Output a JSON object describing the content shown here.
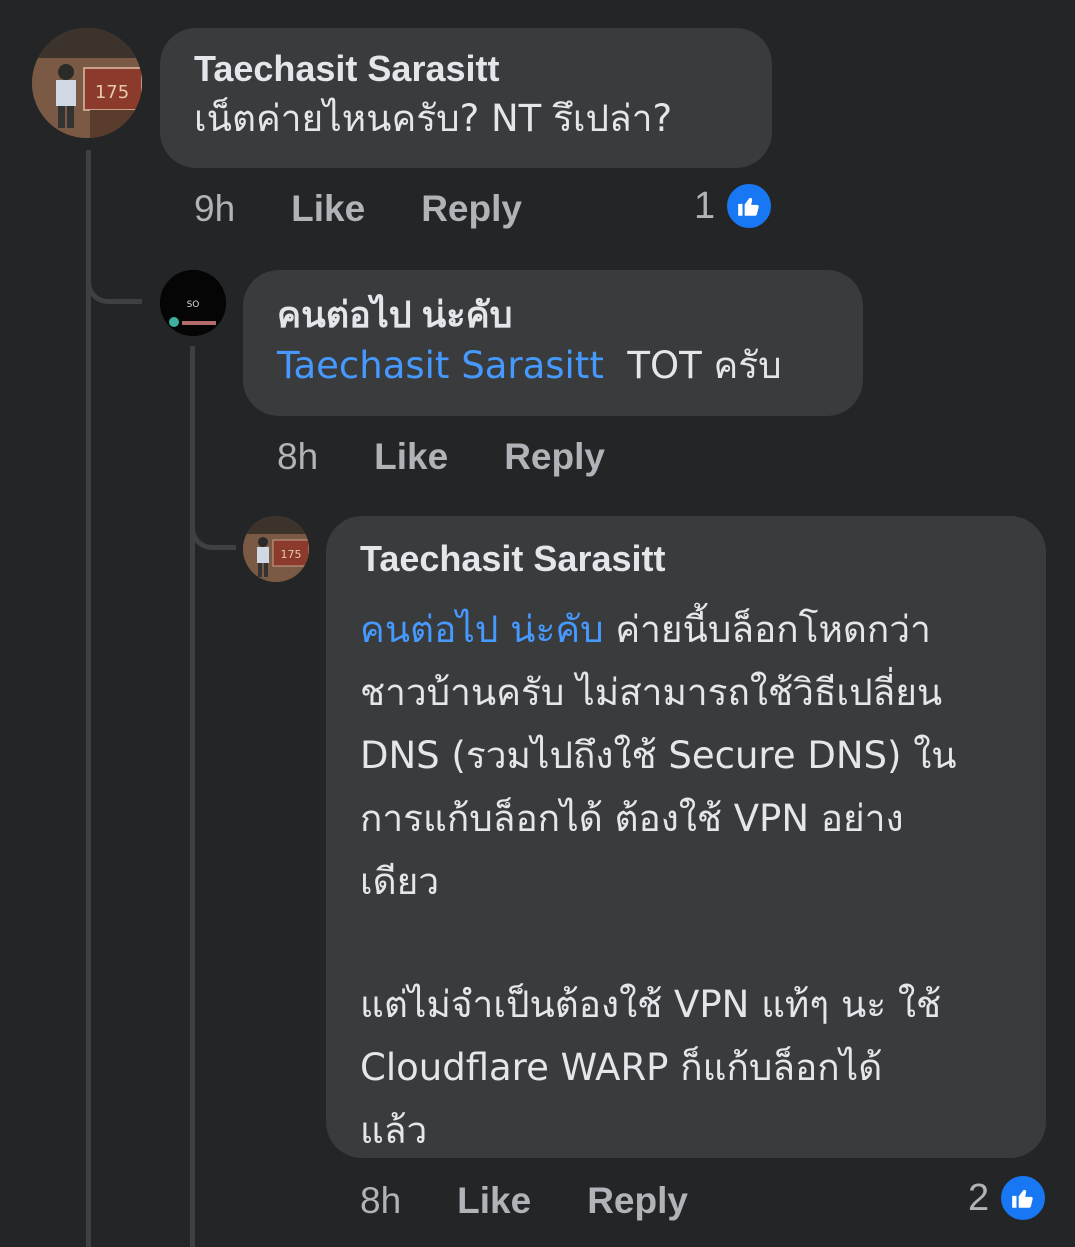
{
  "comments": [
    {
      "author": "Taechasit Sarasitt",
      "text": "เน็ตค่ายไหนครับ? NT รึเปล่า?",
      "time": "9h",
      "like_label": "Like",
      "reply_label": "Reply",
      "reaction_count": "1"
    },
    {
      "author": "คนต่อไป น่ะคับ",
      "mention": "Taechasit Sarasitt",
      "text": "TOT ครับ",
      "time": "8h",
      "like_label": "Like",
      "reply_label": "Reply"
    },
    {
      "author": "Taechasit Sarasitt",
      "mention": "คนต่อไป น่ะคับ",
      "text_lines": [
        "ค่ายนี้บล็อกโหดกว่า",
        "ชาวบ้านครับ ไม่สามารถใช้วิธีเปลี่ยน",
        "DNS (รวมไปถึงใช้ Secure DNS) ใน",
        "การแก้บล็อกได้ ต้องใช้ VPN อย่าง",
        "เดียว",
        "แต่ไม่จำเป็นต้องใช้ VPN แท้ๆ นะ ใช้",
        "Cloudflare WARP ก็แก้บล็อกได้",
        "แล้ว"
      ],
      "time": "8h",
      "like_label": "Like",
      "reply_label": "Reply",
      "reaction_count": "2"
    }
  ],
  "avatars": {
    "taechasit_sign_text": "175",
    "second_user_text": "SO"
  },
  "colors": {
    "background": "#242527",
    "bubble": "#3a3b3c",
    "mention": "#4599ff",
    "like_blue": "#1877f2"
  },
  "icons": [
    "thumbs-up-icon"
  ]
}
